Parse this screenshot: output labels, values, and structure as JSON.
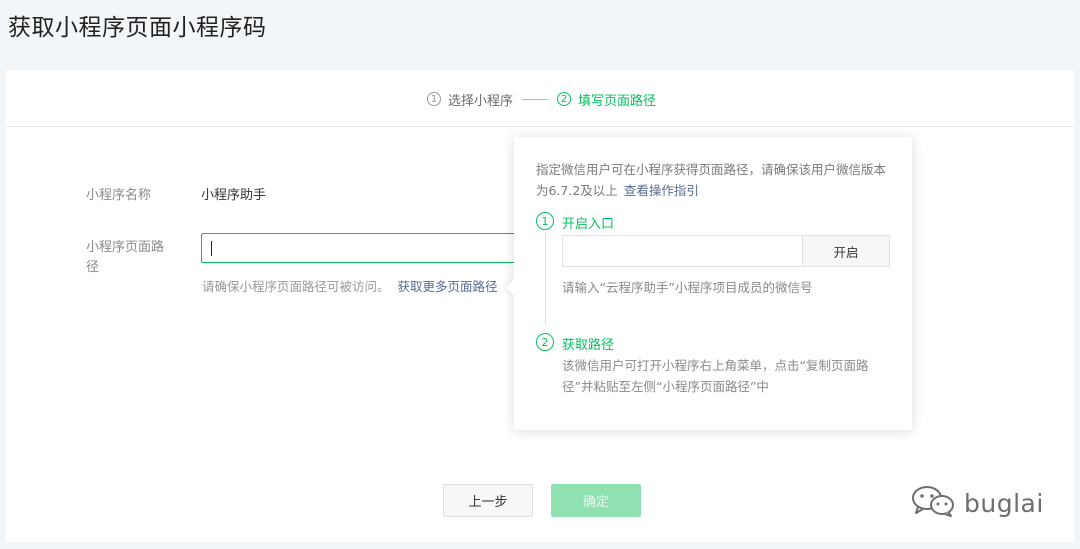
{
  "page": {
    "title": "获取小程序页面小程序码"
  },
  "steps": [
    {
      "num": "1",
      "label": "选择小程序"
    },
    {
      "num": "2",
      "label": "填写页面路径"
    }
  ],
  "form": {
    "name_label": "小程序名称",
    "name_value": "小程序助手",
    "path_label": "小程序页面路径",
    "path_value": "",
    "hint": "请确保小程序页面路径可被访问。",
    "hint_link": "获取更多页面路径"
  },
  "popover": {
    "desc": "指定微信用户可在小程序获得页面路径，请确保该用户微信版本为6.7.2及以上",
    "desc_link": "查看操作指引",
    "step1": {
      "num": "1",
      "title": "开启入口",
      "button": "开启",
      "hint": "请输入“云程序助手”小程序项目成员的微信号"
    },
    "step2": {
      "num": "2",
      "title": "获取路径",
      "hint": "该微信用户可打开小程序右上角菜单，点击“复制页面路径”并粘贴至左侧“小程序页面路径”中"
    }
  },
  "buttons": {
    "prev": "上一步",
    "confirm": "确定"
  },
  "watermark": {
    "text": "buglai",
    "icon": "wechat-icon"
  },
  "colors": {
    "accent": "#07c160",
    "link": "#576b95",
    "disabled_btn": "#8fe1b2"
  }
}
